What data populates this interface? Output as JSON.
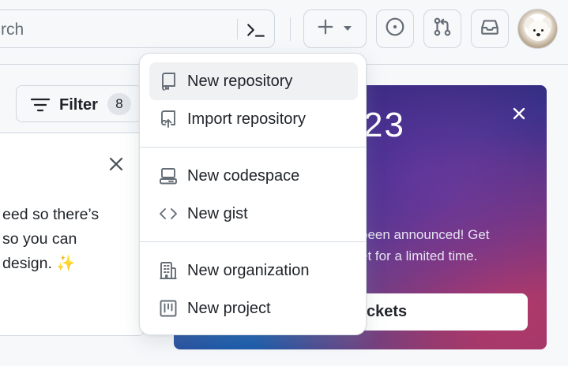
{
  "header": {
    "search_placeholder": "rch",
    "command_palette_icon": "terminal-icon",
    "create_button": {
      "icon": "plus-icon",
      "caret": "triangle-down-icon"
    },
    "issues_button": {
      "icon": "issue-opened-icon"
    },
    "pull_requests_button": {
      "icon": "git-pull-request-icon"
    },
    "inbox_button": {
      "icon": "inbox-icon"
    },
    "avatar": {
      "icon": "user-avatar"
    }
  },
  "filter": {
    "label": "Filter",
    "count": "8"
  },
  "notice": {
    "lines": [
      "eed so there’s",
      " so you can",
      "design. ✨"
    ]
  },
  "promo": {
    "logo_fragment": "23",
    "text_lines": [
      "been announced! Get",
      "et for a limited time."
    ],
    "button_label": "ckets"
  },
  "create_menu": {
    "items": [
      {
        "label": "New repository",
        "icon": "repo-icon",
        "active": true
      },
      {
        "label": "Import repository",
        "icon": "repo-push-icon",
        "active": false
      },
      {
        "label": "New codespace",
        "icon": "codespaces-icon",
        "active": false
      },
      {
        "label": "New gist",
        "icon": "code-icon",
        "active": false
      },
      {
        "label": "New organization",
        "icon": "organization-icon",
        "active": false
      },
      {
        "label": "New project",
        "icon": "project-icon",
        "active": false
      }
    ]
  },
  "colors": {
    "text": "#1f2328",
    "muted_icon": "#656d76",
    "border": "#d0d7de",
    "active_item_bg": "#eff1f3",
    "page_bg": "#f6f8fa"
  }
}
